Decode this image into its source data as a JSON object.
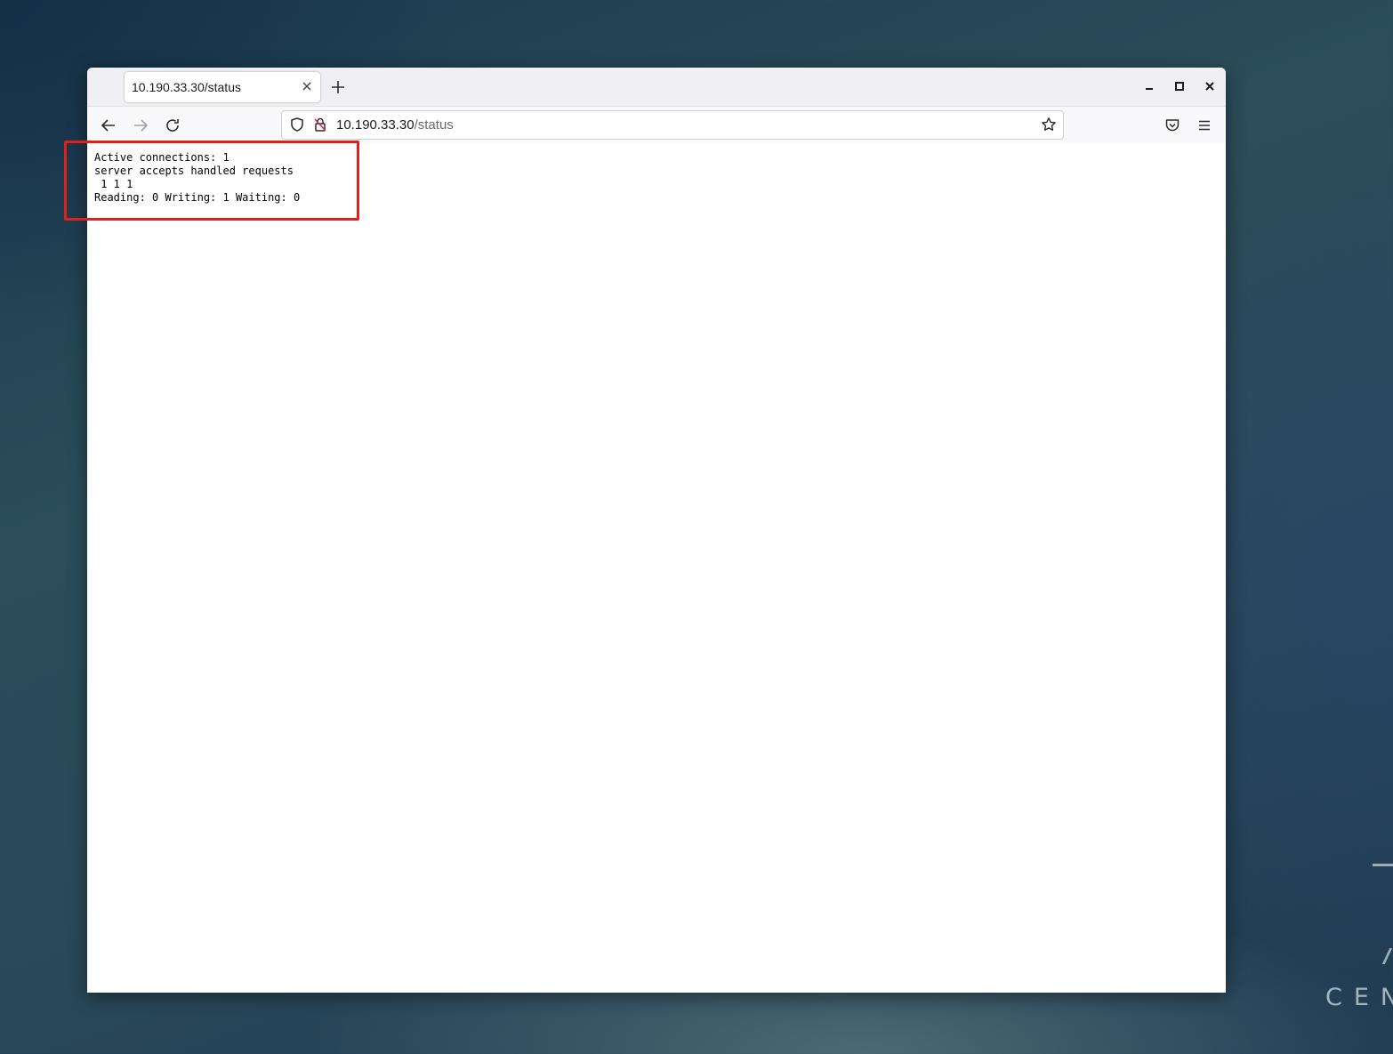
{
  "desktop": {
    "logo_text": "CEN"
  },
  "browser": {
    "tab": {
      "title": "10.190.33.30/status",
      "close_icon": "close-icon"
    },
    "new_tab_icon": "plus-icon",
    "window_controls": [
      "minimize-icon",
      "maximize-icon",
      "close-icon"
    ],
    "nav": {
      "back_icon": "arrow-left-icon",
      "forward_icon": "arrow-right-icon",
      "reload_icon": "reload-icon"
    },
    "urlbar": {
      "host": "10.190.33.30",
      "path": "/status",
      "shield_icon": "tracking-shield-icon",
      "lock_icon": "insecure-lock-icon",
      "bookmark_icon": "star-icon"
    },
    "toolbar": {
      "pocket_icon": "pocket-icon",
      "menu_icon": "hamburger-menu-icon"
    }
  },
  "page": {
    "lines": [
      "Active connections: 1",
      "server accepts handled requests",
      " 1 1 1",
      "Reading: 0 Writing: 1 Waiting: 0"
    ]
  },
  "annotation": {
    "color": "#e0201b"
  }
}
